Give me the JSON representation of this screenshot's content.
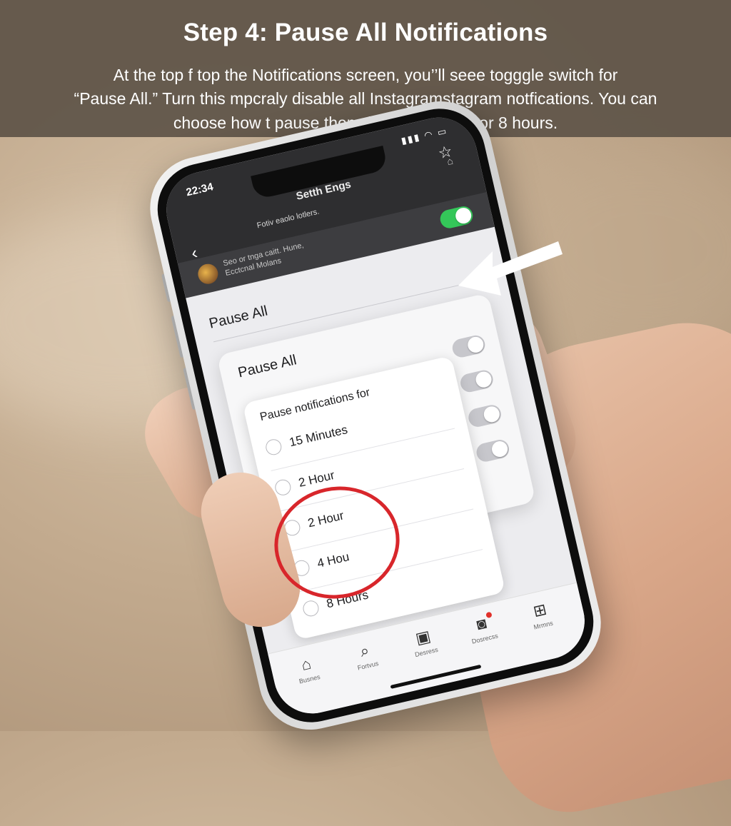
{
  "banner": {
    "title": "Step 4: Pause All Notifications",
    "body_line1": "At the top f top the Notifications screen, you’’ll seee togggle switch for",
    "body_line2": "“Pause All.” Turn this mpcraly disable all Instagramstagram notfications. You can",
    "body_line3": "choose how t pause them (e.pl. 15 hour,/, or 8 hours."
  },
  "phone": {
    "status_time": "22:34",
    "status_icons": "signal-icon wifi-icon battery-icon",
    "header_title": "Setth Engs",
    "header_sub": "Fotiv eaolo lotlers.",
    "account_line1": "Seo or tnga caitt. Hune,",
    "account_line2": "Ecctcnal Molans",
    "pause_all_toggle": "on",
    "pause_all_label": "Pause All",
    "card_title": "Pause All",
    "sheet_header": "Pause notifications for",
    "options": [
      {
        "label": "15 Minutes"
      },
      {
        "label": "2 Hour"
      },
      {
        "label": "2 Hour"
      },
      {
        "label": "4 Hou"
      },
      {
        "label": "8 Hours"
      }
    ],
    "tabs": [
      {
        "icon": "home-icon",
        "label": "Busnes"
      },
      {
        "icon": "search-icon",
        "label": "Fortvus"
      },
      {
        "icon": "square-icon",
        "label": "Desress"
      },
      {
        "icon": "camera-icon",
        "label": "Dosrecss"
      },
      {
        "icon": "add-icon",
        "label": "Mrmns"
      }
    ]
  },
  "colors": {
    "banner_bg": "#5f5448",
    "toggle_on": "#34c759",
    "highlight": "#d8262b"
  }
}
